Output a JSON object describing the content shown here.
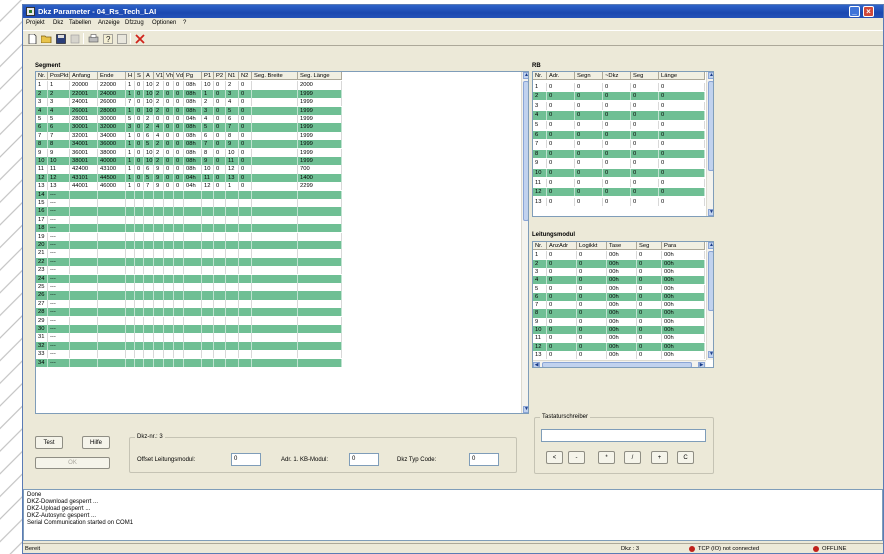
{
  "window": {
    "title": "Dkz Parameter - 04_Rs_Tech_LAI"
  },
  "menu": [
    "Projekt",
    "Dkz",
    "Tabellen",
    "Anzeige",
    "Dfzzug",
    "Optionen",
    "?"
  ],
  "colors": {
    "row_even": "#6fbf94",
    "row_odd": "#ffffff",
    "title_bar": "#1b48b0",
    "status_offline": "#c0221b"
  },
  "segment": {
    "label": "Segment",
    "columns": [
      "Nr.",
      "PosPkt",
      "Anfang",
      "Ende",
      "H",
      "S",
      "A",
      "V1",
      "Vh",
      "Vd",
      "Pg",
      "P1",
      "P2",
      "N1",
      "N2",
      "Seg. Breite",
      "Seg. Länge"
    ],
    "rows": [
      [
        "1",
        "1",
        "20000",
        "22000",
        "1",
        "0",
        "10",
        "2",
        "0",
        "0",
        "08h",
        "10",
        "0",
        "2",
        "0",
        "",
        "2000"
      ],
      [
        "2",
        "2",
        "22001",
        "24000",
        "1",
        "0",
        "10",
        "2",
        "0",
        "0",
        "08h",
        "1",
        "0",
        "3",
        "0",
        "",
        "1999"
      ],
      [
        "3",
        "3",
        "24001",
        "26000",
        "7",
        "0",
        "10",
        "2",
        "0",
        "0",
        "08h",
        "2",
        "0",
        "4",
        "0",
        "",
        "1999"
      ],
      [
        "4",
        "4",
        "26001",
        "28000",
        "1",
        "0",
        "10",
        "2",
        "0",
        "0",
        "08h",
        "3",
        "0",
        "5",
        "0",
        "",
        "1999"
      ],
      [
        "5",
        "5",
        "28001",
        "30000",
        "5",
        "0",
        "2",
        "0",
        "0",
        "0",
        "04h",
        "4",
        "0",
        "6",
        "0",
        "",
        "1999"
      ],
      [
        "6",
        "6",
        "30001",
        "32000",
        "3",
        "0",
        "2",
        "4",
        "0",
        "0",
        "08h",
        "5",
        "0",
        "7",
        "0",
        "",
        "1999"
      ],
      [
        "7",
        "7",
        "32001",
        "34000",
        "1",
        "0",
        "6",
        "4",
        "0",
        "0",
        "08h",
        "6",
        "0",
        "8",
        "0",
        "",
        "1999"
      ],
      [
        "8",
        "8",
        "34001",
        "36000",
        "1",
        "0",
        "5",
        "2",
        "0",
        "0",
        "08h",
        "7",
        "0",
        "9",
        "0",
        "",
        "1999"
      ],
      [
        "9",
        "9",
        "36001",
        "38000",
        "1",
        "0",
        "10",
        "2",
        "0",
        "0",
        "08h",
        "8",
        "0",
        "10",
        "0",
        "",
        "1999"
      ],
      [
        "10",
        "10",
        "38001",
        "40000",
        "1",
        "0",
        "10",
        "2",
        "0",
        "0",
        "08h",
        "9",
        "0",
        "11",
        "0",
        "",
        "1999"
      ],
      [
        "11",
        "11",
        "42400",
        "43100",
        "1",
        "0",
        "6",
        "9",
        "0",
        "0",
        "08h",
        "10",
        "0",
        "12",
        "0",
        "",
        "700"
      ],
      [
        "12",
        "12",
        "43101",
        "44500",
        "1",
        "0",
        "5",
        "9",
        "0",
        "0",
        "04h",
        "11",
        "0",
        "13",
        "0",
        "",
        "1400"
      ],
      [
        "13",
        "13",
        "44001",
        "46000",
        "1",
        "0",
        "7",
        "9",
        "0",
        "0",
        "04h",
        "12",
        "0",
        "1",
        "0",
        "",
        "2299"
      ],
      [
        "14",
        "---"
      ],
      [
        "15",
        "---"
      ],
      [
        "16",
        "---"
      ],
      [
        "17",
        "---"
      ],
      [
        "18",
        "---"
      ],
      [
        "19",
        "---"
      ],
      [
        "20",
        "---"
      ],
      [
        "21",
        "---"
      ],
      [
        "22",
        "---"
      ],
      [
        "23",
        "---"
      ],
      [
        "24",
        "---"
      ],
      [
        "25",
        "---"
      ],
      [
        "26",
        "---"
      ],
      [
        "27",
        "---"
      ],
      [
        "28",
        "---"
      ],
      [
        "29",
        "---"
      ],
      [
        "30",
        "---"
      ],
      [
        "31",
        "---"
      ],
      [
        "32",
        "---"
      ],
      [
        "33",
        "---"
      ],
      [
        "34",
        "---"
      ]
    ]
  },
  "rb": {
    "label": "RB",
    "columns": [
      "Nr.",
      "Adr.",
      "Segn",
      "~Dkz",
      "Seg",
      "Länge"
    ],
    "rows": [
      [
        "1",
        "0",
        "0",
        "0",
        "0",
        "0"
      ],
      [
        "2",
        "0",
        "0",
        "0",
        "0",
        "0"
      ],
      [
        "3",
        "0",
        "0",
        "0",
        "0",
        "0"
      ],
      [
        "4",
        "0",
        "0",
        "0",
        "0",
        "0"
      ],
      [
        "5",
        "0",
        "0",
        "0",
        "0",
        "0"
      ],
      [
        "6",
        "0",
        "0",
        "0",
        "0",
        "0"
      ],
      [
        "7",
        "0",
        "0",
        "0",
        "0",
        "0"
      ],
      [
        "8",
        "0",
        "0",
        "0",
        "0",
        "0"
      ],
      [
        "9",
        "0",
        "0",
        "0",
        "0",
        "0"
      ],
      [
        "10",
        "0",
        "0",
        "0",
        "0",
        "0"
      ],
      [
        "11",
        "0",
        "0",
        "0",
        "0",
        "0"
      ],
      [
        "12",
        "0",
        "0",
        "0",
        "0",
        "0"
      ],
      [
        "13",
        "0",
        "0",
        "0",
        "0",
        "0"
      ]
    ]
  },
  "leitung": {
    "label": "Leitungsmodul",
    "columns": [
      "Nr.",
      "AnzAdr",
      "Logikkt",
      "Tase",
      "Seg",
      "Para"
    ],
    "rows": [
      [
        "1",
        "0",
        "0",
        "00h",
        "0",
        "00h"
      ],
      [
        "2",
        "0",
        "0",
        "00h",
        "0",
        "00h"
      ],
      [
        "3",
        "0",
        "0",
        "00h",
        "0",
        "00h"
      ],
      [
        "4",
        "0",
        "0",
        "00h",
        "0",
        "00h"
      ],
      [
        "5",
        "0",
        "0",
        "00h",
        "0",
        "00h"
      ],
      [
        "6",
        "0",
        "0",
        "00h",
        "0",
        "00h"
      ],
      [
        "7",
        "0",
        "0",
        "00h",
        "0",
        "00h"
      ],
      [
        "8",
        "0",
        "0",
        "00h",
        "0",
        "00h"
      ],
      [
        "9",
        "0",
        "0",
        "00h",
        "0",
        "00h"
      ],
      [
        "10",
        "0",
        "0",
        "00h",
        "0",
        "00h"
      ],
      [
        "11",
        "0",
        "0",
        "00h",
        "0",
        "00h"
      ],
      [
        "12",
        "0",
        "0",
        "00h",
        "0",
        "00h"
      ],
      [
        "13",
        "0",
        "0",
        "00h",
        "0",
        "00h"
      ]
    ]
  },
  "controls": {
    "test": "Test",
    "hilfe": "Hilfe",
    "ok": "OK",
    "dkz_label": "Dkz-nr.: 3",
    "offset_label": "Offset Leitungsmodul:",
    "offset_value": "0",
    "adr_label": "Adr. 1. KB-Modul:",
    "adr_value": "0",
    "typ_label": "Dkz Typ Code:",
    "typ_value": "0"
  },
  "keypad": {
    "label": "Tastaturschreiber",
    "keys": [
      "<",
      "-",
      "*",
      "/",
      "+",
      "C"
    ]
  },
  "log": [
    "Done",
    "DKZ-Download gesperrt ...",
    "DKZ-Upload gesperrt ...",
    "DKZ-Autosync gesperrt ...",
    "Serial Communication started on COM1"
  ],
  "status": {
    "left": "Bereit",
    "dkz": "Dkz : 3",
    "tcp": "TCP (IO) not connected",
    "offline": "OFFLINE"
  }
}
